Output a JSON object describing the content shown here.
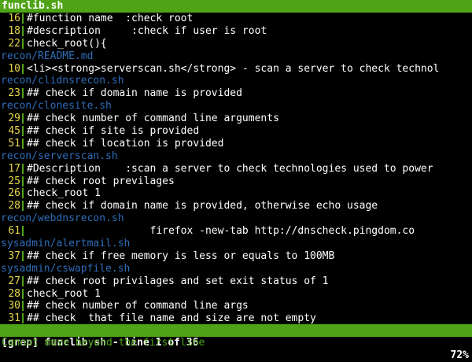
{
  "title": "funclib.sh",
  "rows": [
    {
      "type": "code",
      "num": "16",
      "text": "#function name  :check root"
    },
    {
      "type": "code",
      "num": "18",
      "text": "#description     :check if user is root"
    },
    {
      "type": "code",
      "num": "22",
      "text": "check_root(){"
    },
    {
      "type": "file",
      "text": "recon/README.md"
    },
    {
      "type": "code",
      "num": "10",
      "text": "<li><strong>serverscan.sh</strong> - scan a server to check technol"
    },
    {
      "type": "file",
      "text": "recon/clidnsrecon.sh"
    },
    {
      "type": "code",
      "num": "23",
      "text": "## check if domain name is provided"
    },
    {
      "type": "file",
      "text": "recon/clonesite.sh"
    },
    {
      "type": "code",
      "num": "29",
      "text": "## check number of command line arguments"
    },
    {
      "type": "code",
      "num": "45",
      "text": "## check if site is provided"
    },
    {
      "type": "code",
      "num": "51",
      "text": "## check if location is provided"
    },
    {
      "type": "file",
      "text": "recon/serverscan.sh"
    },
    {
      "type": "code",
      "num": "17",
      "text": "#Description    :scan a server to check technologies used to power"
    },
    {
      "type": "code",
      "num": "25",
      "text": "## check root previlages"
    },
    {
      "type": "code",
      "num": "26",
      "text": "check_root 1"
    },
    {
      "type": "code",
      "num": "28",
      "text": "## check if domain name is provided, otherwise echo usage"
    },
    {
      "type": "file",
      "text": "recon/webdnsrecon.sh"
    },
    {
      "type": "code",
      "num": "61",
      "text": "                    firefox -new-tab http://dnscheck.pingdom.co"
    },
    {
      "type": "file",
      "text": "sysadmin/alertmail.sh"
    },
    {
      "type": "code",
      "num": "37",
      "text": "## check if free memory is less or equals to 100MB"
    },
    {
      "type": "file",
      "text": "sysadmin/cswapfile.sh"
    },
    {
      "type": "code",
      "num": "27",
      "text": "## check root privilages and set exit status of 1"
    },
    {
      "type": "code",
      "num": "28",
      "text": "check_root 1"
    },
    {
      "type": "code",
      "num": "30",
      "text": "## check number of command line args"
    },
    {
      "type": "code",
      "num": "31",
      "text": "## check  that file name and size are not empty"
    }
  ],
  "status": {
    "left": "[grep] funclib.sh - line 1 of 36",
    "right": "72%"
  },
  "message": "Cannot move beyond the first line"
}
